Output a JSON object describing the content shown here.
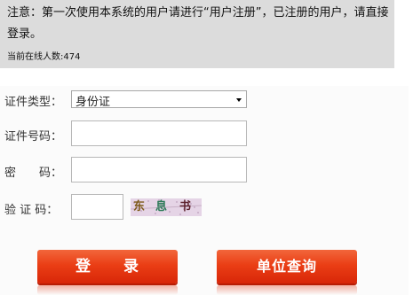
{
  "notice": {
    "text": "注意：第一次使用本系统的用户请进行“用户注册”，已注册的用户，请直接登录。",
    "online_label": "当前在线人数:",
    "online_count": "474"
  },
  "form": {
    "cert_type_label": "证件类型：",
    "cert_type_value": "身份证",
    "cert_no_label": "证件号码：",
    "password_label": "密　　码：",
    "captcha_label": "验 证 码："
  },
  "captcha": {
    "chars": [
      "东",
      "息",
      "书"
    ],
    "colors": [
      "#7d5a1a",
      "#2f7b5a",
      "#5b1f2b"
    ]
  },
  "buttons": {
    "login_label": "登　　录",
    "unit_query_label": "单位查询"
  },
  "colors": {
    "button_red": "#e63d16",
    "notice_bg": "#dcdcdc"
  }
}
